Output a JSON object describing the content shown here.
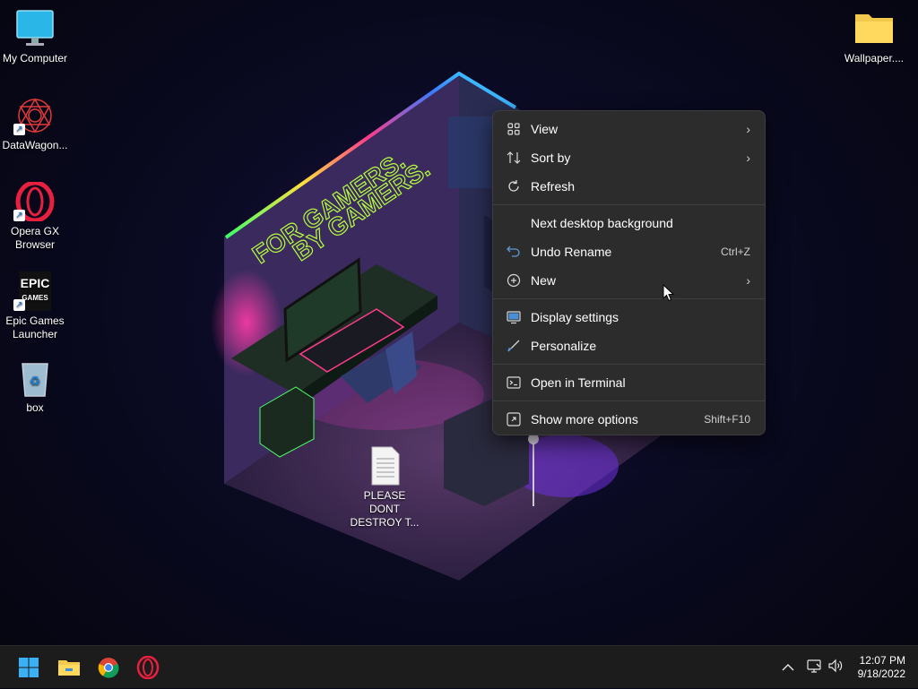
{
  "desktop": {
    "icons": [
      {
        "label": "My Computer"
      },
      {
        "label": "DataWagon..."
      },
      {
        "label": "Opera GX Browser"
      },
      {
        "label": "Epic Games Launcher"
      },
      {
        "label": "box"
      },
      {
        "label": "Wallpaper...."
      },
      {
        "label": "PLEASE DONT DESTROY T..."
      }
    ],
    "wallpaper_text": "FOR GAMERS. BY GAMERS."
  },
  "context_menu": {
    "items": [
      {
        "label": "View",
        "icon": "grid-icon",
        "submenu": true
      },
      {
        "label": "Sort by",
        "icon": "sort-icon",
        "submenu": true
      },
      {
        "label": "Refresh",
        "icon": "refresh-icon"
      },
      {
        "label": "Next desktop background"
      },
      {
        "label": "Undo Rename",
        "icon": "undo-icon",
        "shortcut": "Ctrl+Z"
      },
      {
        "label": "New",
        "icon": "plus-circle-icon",
        "submenu": true
      },
      {
        "label": "Display settings",
        "icon": "display-icon"
      },
      {
        "label": "Personalize",
        "icon": "brush-icon"
      },
      {
        "label": "Open in Terminal",
        "icon": "terminal-icon"
      },
      {
        "label": "Show more options",
        "icon": "more-options-icon",
        "shortcut": "Shift+F10"
      }
    ]
  },
  "taskbar": {
    "apps": [
      "start-icon",
      "file-explorer-icon",
      "chrome-icon",
      "opera-gx-icon"
    ],
    "time": "12:07 PM",
    "date": "9/18/2022"
  },
  "colors": {
    "menu_bg": "#2c2c2c",
    "taskbar_bg": "#1c1c1c",
    "neon_green": "#b6ff3b"
  }
}
